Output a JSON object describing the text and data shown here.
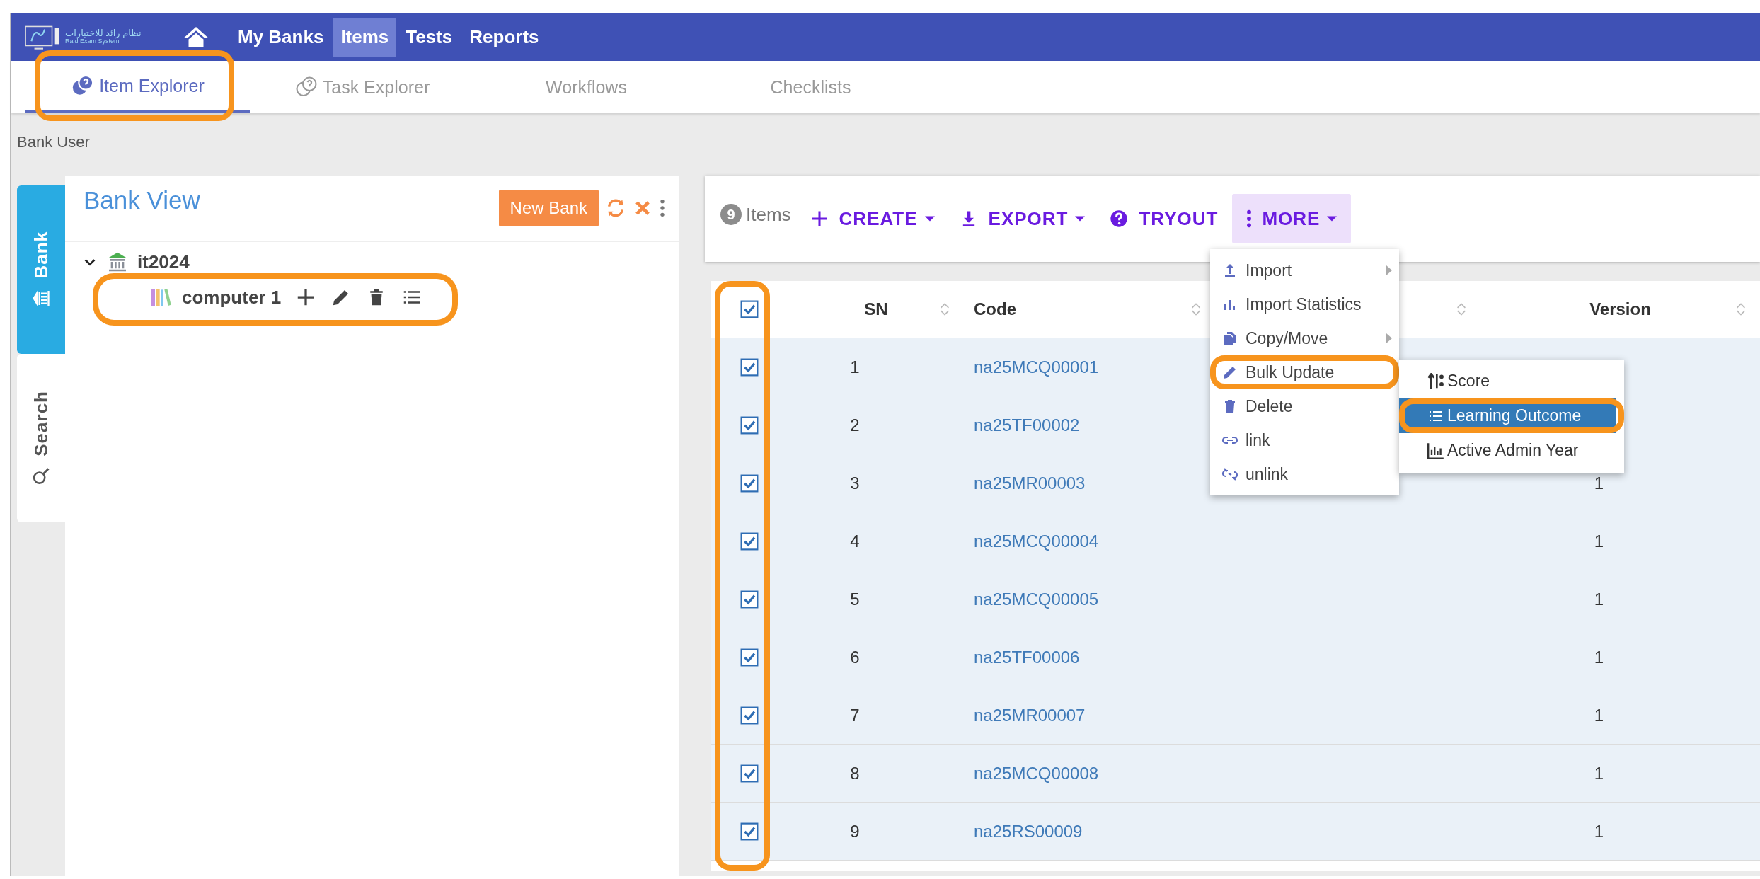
{
  "logo": {
    "title": "نظام رائد للاختبارات",
    "subtitle": "Raid Exam System"
  },
  "nav": [
    {
      "label": "My Banks",
      "selected": false
    },
    {
      "label": "Items",
      "selected": true
    },
    {
      "label": "Tests",
      "selected": false
    },
    {
      "label": "Reports",
      "selected": false
    }
  ],
  "tabs": [
    {
      "label": "Item Explorer",
      "selected": true,
      "highlighted": true
    },
    {
      "label": "Task Explorer",
      "selected": false,
      "highlighted": false
    },
    {
      "label": "Workflows",
      "selected": false,
      "highlighted": false
    },
    {
      "label": "Checklists",
      "selected": false,
      "highlighted": false
    }
  ],
  "breadcrumb": "Bank User",
  "side_tabs": [
    {
      "label": "Bank",
      "selected": true
    },
    {
      "label": "Search",
      "selected": false
    }
  ],
  "bank_view": {
    "title": "Bank View",
    "new_button": "New Bank",
    "tree": [
      {
        "label": "it2024",
        "kind": "bank",
        "expanded": true,
        "highlighted": false,
        "children": [
          {
            "label": "computer 1",
            "kind": "subject",
            "highlighted": true
          }
        ]
      }
    ]
  },
  "toolbar": {
    "count": "9",
    "count_label": "Items",
    "actions": [
      {
        "label": "CREATE",
        "dropdown": true,
        "selected": false
      },
      {
        "label": "EXPORT",
        "dropdown": true,
        "selected": false
      },
      {
        "label": "TRYOUT",
        "dropdown": false,
        "selected": false
      },
      {
        "label": "MORE",
        "dropdown": true,
        "selected": true
      }
    ]
  },
  "more_menu": [
    {
      "label": "Import",
      "submenu": true,
      "highlighted": false
    },
    {
      "label": "Import Statistics",
      "submenu": false,
      "highlighted": false
    },
    {
      "label": "Copy/Move",
      "submenu": true,
      "highlighted": false
    },
    {
      "label": "Bulk Update",
      "submenu": false,
      "highlighted": true
    },
    {
      "label": "Delete",
      "submenu": false,
      "highlighted": false
    },
    {
      "label": "link",
      "submenu": false,
      "highlighted": false
    },
    {
      "label": "unlink",
      "submenu": false,
      "highlighted": false
    }
  ],
  "bulk_submenu": [
    {
      "label": "Score",
      "selected": false,
      "highlighted": false
    },
    {
      "label": "Learning Outcome",
      "selected": true,
      "highlighted": true
    },
    {
      "label": "Active Admin Year",
      "selected": false,
      "highlighted": false
    }
  ],
  "table": {
    "select_all": true,
    "checkbox_column_highlighted": true,
    "columns": [
      {
        "label": "SN"
      },
      {
        "label": "Code"
      },
      {},
      {
        "label": "Version"
      }
    ],
    "rows": [
      {
        "checked": true,
        "sn": "1",
        "code": "na25MCQ00001"
      },
      {
        "checked": true,
        "sn": "2",
        "code": "na25TF00002"
      },
      {
        "checked": true,
        "sn": "3",
        "code": "na25MR00003",
        "version": "1"
      },
      {
        "checked": true,
        "sn": "4",
        "code": "na25MCQ00004",
        "version": "1"
      },
      {
        "checked": true,
        "sn": "5",
        "code": "na25MCQ00005",
        "version": "1"
      },
      {
        "checked": true,
        "sn": "6",
        "code": "na25TF00006",
        "version": "1"
      },
      {
        "checked": true,
        "sn": "7",
        "code": "na25MR00007",
        "version": "1"
      },
      {
        "checked": true,
        "sn": "8",
        "code": "na25MCQ00008",
        "version": "1"
      },
      {
        "checked": true,
        "sn": "9",
        "code": "na25RS00009",
        "version": "1"
      }
    ]
  }
}
